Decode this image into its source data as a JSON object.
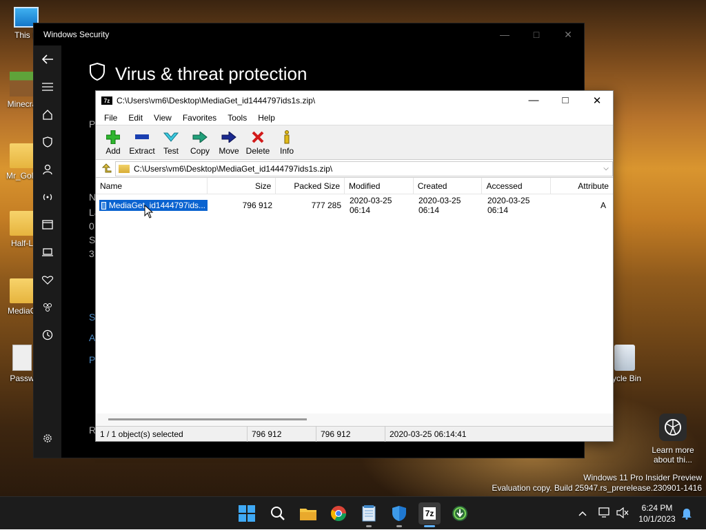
{
  "desktop": {
    "icons": [
      {
        "label": "This P"
      },
      {
        "label": "Minecra"
      },
      {
        "label": "Mr_Gold"
      },
      {
        "label": "Half-L"
      },
      {
        "label": "MediaG"
      },
      {
        "label": "Passw"
      },
      {
        "label": "cycle Bin"
      }
    ],
    "learn_more": "Learn more about thi...",
    "watermark_line1": "Windows 11 Pro Insider Preview",
    "watermark_line2": "Evaluation copy. Build 25947.rs_prerelease.230901-1416"
  },
  "windows_security": {
    "title": "Windows Security",
    "heading": "Virus & threat protection",
    "fragments": [
      "Pr",
      "N",
      "La",
      "0",
      "S",
      "3",
      "S",
      "A",
      "P",
      "R"
    ]
  },
  "zip": {
    "title": "C:\\Users\\vm6\\Desktop\\MediaGet_id1444797ids1s.zip\\",
    "menu": [
      "File",
      "Edit",
      "View",
      "Favorites",
      "Tools",
      "Help"
    ],
    "toolbar": [
      "Add",
      "Extract",
      "Test",
      "Copy",
      "Move",
      "Delete",
      "Info"
    ],
    "address": "C:\\Users\\vm6\\Desktop\\MediaGet_id1444797ids1s.zip\\",
    "columns": [
      "Name",
      "Size",
      "Packed Size",
      "Modified",
      "Created",
      "Accessed",
      "Attribute"
    ],
    "rows": [
      {
        "name": "MediaGet_id1444797ids...",
        "size": "796 912",
        "packed": "777 285",
        "modified": "2020-03-25 06:14",
        "created": "2020-03-25 06:14",
        "accessed": "2020-03-25 06:14",
        "attr": "A"
      }
    ],
    "status": {
      "selected": "1 / 1 object(s) selected",
      "size": "796 912",
      "packed": "796 912",
      "date": "2020-03-25 06:14:41"
    }
  },
  "taskbar": {
    "time": "6:24 PM",
    "date": "10/1/2023"
  }
}
